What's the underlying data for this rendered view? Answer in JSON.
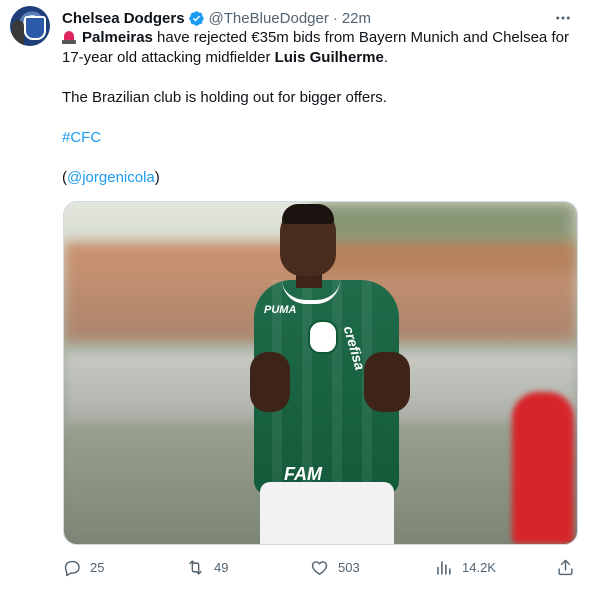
{
  "tweet": {
    "author_name": "Chelsea Dodgers",
    "handle": "@TheBlueDodger",
    "separator": "·",
    "time": "22m",
    "line1_bold": "Palmeiras",
    "line1_rest": " have rejected €35m bids from Bayern Munich and Chelsea for 17-year old attacking midfielder ",
    "line1_bold2": "Luis Guilherme",
    "line1_end": ".",
    "paragraph2": "The Brazilian club is holding out for bigger offers.",
    "hashtag": "#CFC",
    "mention_open": "(",
    "mention": "@jorgenicola",
    "mention_close": ")"
  },
  "media": {
    "jersey_sponsor": "crefisa",
    "shirt_brand": "PUMA",
    "chest_text": "FAM"
  },
  "actions": {
    "replies": "25",
    "retweets": "49",
    "likes": "503",
    "views": "14.2K"
  },
  "icons": {
    "verified": "verified-badge-icon",
    "more": "more-options-icon",
    "alert": "police-car-light-icon",
    "reply": "reply-icon",
    "retweet": "retweet-icon",
    "like": "heart-icon",
    "views": "analytics-icon",
    "share": "share-icon"
  },
  "colors": {
    "link": "#1d9bf0",
    "secondary_text": "#536471",
    "verified": "#1d9bf0"
  }
}
